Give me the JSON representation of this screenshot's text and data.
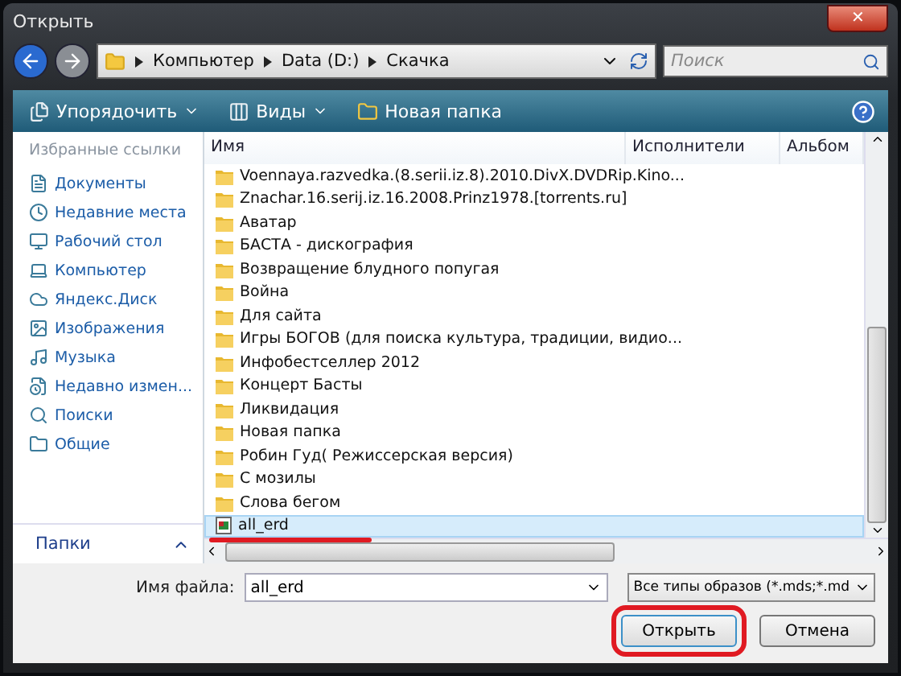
{
  "window": {
    "title": "Открыть",
    "close": "✕"
  },
  "address": {
    "crumbs": [
      "Компьютер",
      "Data (D:)",
      "Скачка"
    ],
    "search_placeholder": "Поиск"
  },
  "toolbar": {
    "buttons": [
      "Упорядочить",
      "Виды",
      "Новая папка"
    ]
  },
  "sidebar": {
    "heading": "Избранные ссылки",
    "items": [
      {
        "label": "Документы"
      },
      {
        "label": "Недавние места"
      },
      {
        "label": "Рабочий стол"
      },
      {
        "label": "Компьютер"
      },
      {
        "label": "Яндекс.Диск"
      },
      {
        "label": "Изображения"
      },
      {
        "label": "Музыка"
      },
      {
        "label": "Недавно измен..."
      },
      {
        "label": "Поиски"
      },
      {
        "label": "Общие"
      }
    ],
    "folders_label": "Папки"
  },
  "table": {
    "columns": [
      "Имя",
      "Исполнители",
      "Альбом"
    ],
    "rows": [
      {
        "name": "Voennaya.razvedka.(8.serii.iz.8).2010.DivX.DVDRip.Kino...",
        "kind": "folder",
        "selected": false
      },
      {
        "name": "Znachar.16.serij.iz.16.2008.Prinz1978.[torrents.ru]",
        "kind": "folder",
        "selected": false
      },
      {
        "name": "Аватар",
        "kind": "folder",
        "selected": false
      },
      {
        "name": "БАСТА - дискография",
        "kind": "folder",
        "selected": false
      },
      {
        "name": "Возвращение блудного попугая",
        "kind": "folder",
        "selected": false
      },
      {
        "name": "Война",
        "kind": "folder",
        "selected": false
      },
      {
        "name": "Для сайта",
        "kind": "folder",
        "selected": false
      },
      {
        "name": "Игры БОГОВ (для поиска культура, традиции, видио...",
        "kind": "folder",
        "selected": false
      },
      {
        "name": "Инфобестселлер 2012",
        "kind": "folder",
        "selected": false
      },
      {
        "name": "Концерт Басты",
        "kind": "folder",
        "selected": false
      },
      {
        "name": "Ликвидация",
        "kind": "folder",
        "selected": false
      },
      {
        "name": "Новая папка",
        "kind": "folder",
        "selected": false
      },
      {
        "name": "Робин Гуд( Режиссерская версия)",
        "kind": "folder",
        "selected": false
      },
      {
        "name": "С мозилы",
        "kind": "folder",
        "selected": false
      },
      {
        "name": "Слова бегом",
        "kind": "folder",
        "selected": false
      },
      {
        "name": "all_erd",
        "kind": "file",
        "selected": true
      }
    ]
  },
  "footer": {
    "filename_label": "Имя файла:",
    "filename": "all_erd",
    "filter": "Все типы образов (*.mds;*.md",
    "buttons": [
      "Открыть",
      "Отмена"
    ]
  }
}
